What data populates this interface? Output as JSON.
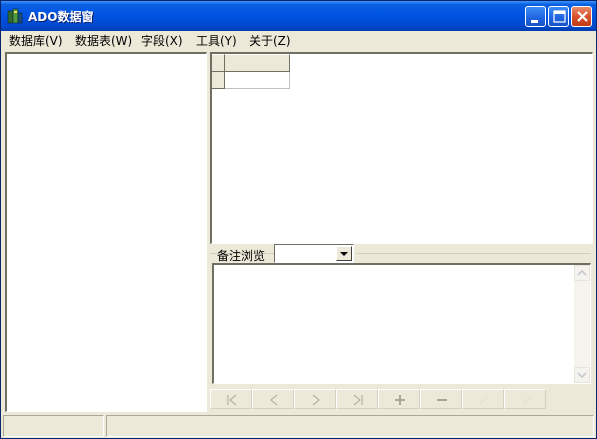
{
  "window": {
    "title": "ADO数据窗",
    "accent_color": "#0054e3"
  },
  "menu": [
    {
      "label": "数据库(V)"
    },
    {
      "label": "数据表(W)"
    },
    {
      "label": "字段(X)"
    },
    {
      "label": "工具(Y)"
    },
    {
      "label": "关于(Z)"
    }
  ],
  "notes": {
    "label": "备注浏览",
    "selected": ""
  },
  "navigator": {
    "buttons": [
      "first-icon",
      "prior-icon",
      "next-icon",
      "last-icon",
      "insert-icon",
      "delete-icon",
      "edit-icon",
      "post-icon"
    ]
  },
  "statusbar": {
    "panel1": "",
    "panel2": ""
  }
}
